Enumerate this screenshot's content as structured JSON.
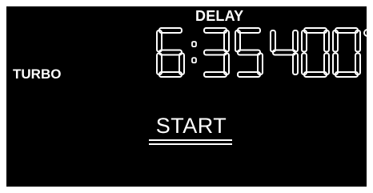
{
  "display": {
    "mode_label": "TURBO",
    "delay_label": "DELAY",
    "time": "6:35",
    "temperature": "400",
    "temperature_unit": "°",
    "start_label": "START"
  },
  "colors": {
    "background": "#000000",
    "foreground": "#ffffff"
  }
}
